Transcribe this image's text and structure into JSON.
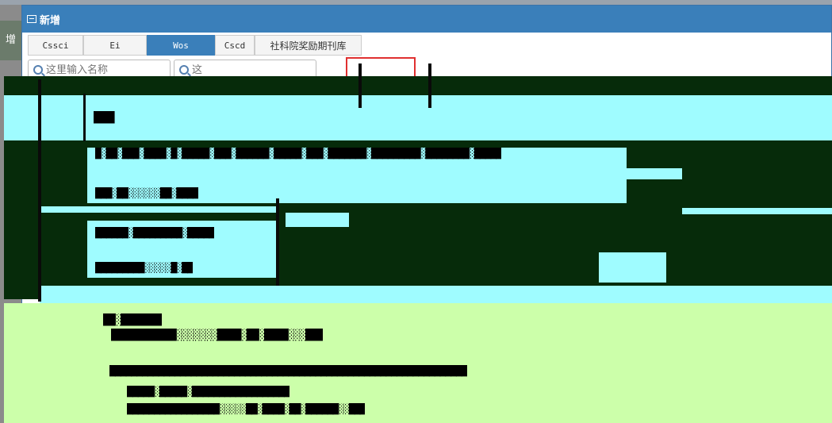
{
  "left_tab": "增",
  "dialog": {
    "title": "新增",
    "tabs": [
      "Cssci",
      "Ei",
      "Wos",
      "Cscd",
      "社科院奖励期刊库"
    ],
    "active_tab": "Wos",
    "search": {
      "placeholder_1": "这里输入名称",
      "placeholder_2": "这"
    }
  },
  "colors": {
    "title_bar": "#3a7fba",
    "active_tab": "#3a7fba",
    "dark_overlay": "#062b0a",
    "cyan_overlay": "#9ffcff",
    "lime_overlay": "#ccffaa",
    "highlight_box": "#e03030"
  }
}
